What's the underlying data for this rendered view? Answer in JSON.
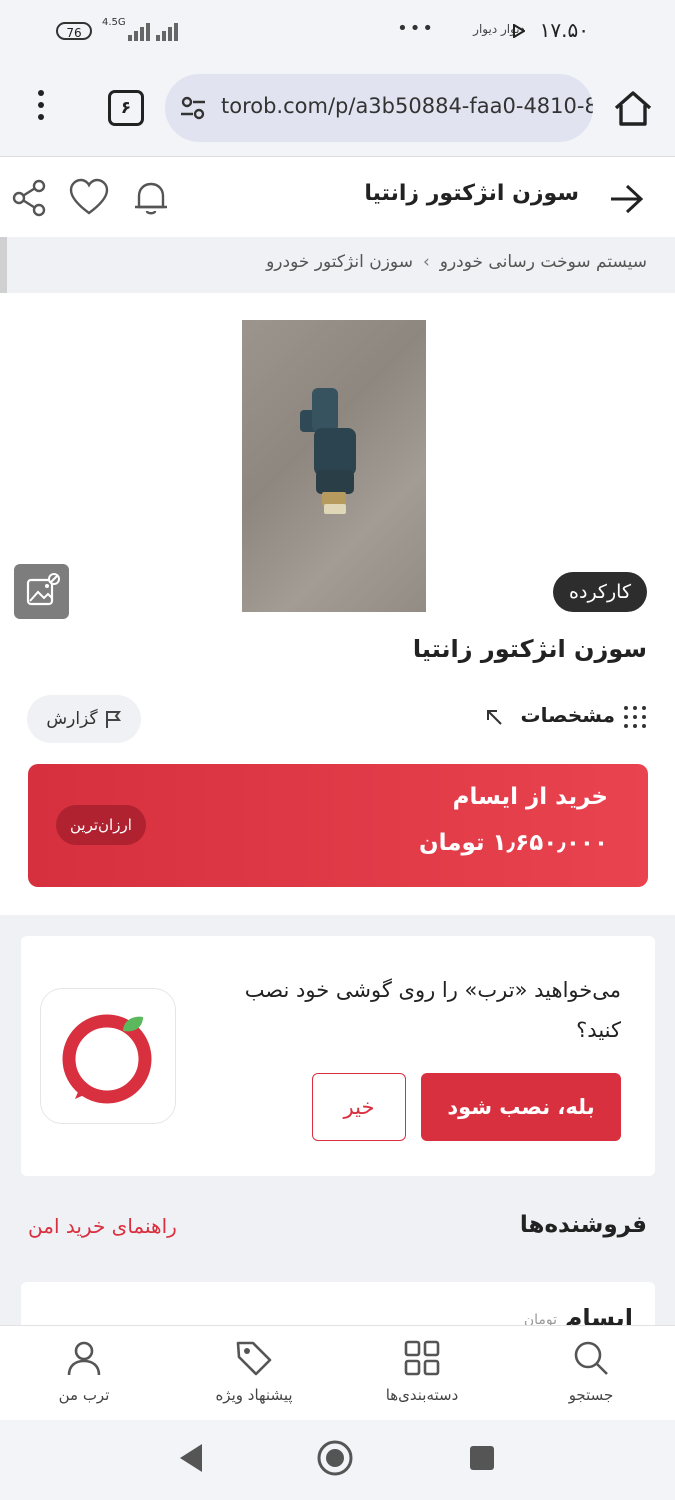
{
  "status_bar": {
    "time": "۱۷.۵۰",
    "apps": "دیوار  دیوار",
    "more": "•••",
    "battery": "76",
    "network": "4.5G"
  },
  "browser": {
    "url": "torob.com/p/a3b50884-faa0-4810-8",
    "tabs_count": "۶"
  },
  "header": {
    "title": "سوزن انژکتور زانتیا"
  },
  "breadcrumb": {
    "items": [
      "سیستم سوخت رسانی خودرو",
      "سوزن انژکتور خودرو"
    ],
    "separator": "›"
  },
  "product": {
    "condition_badge": "کارکرده",
    "title": "سوزن انژکتور زانتیا",
    "specs_label": "مشخصات",
    "report_label": "گزارش",
    "buy": {
      "seller_line": "خرید از ایسام",
      "price_line": "۱٫۶۵۰٫۰۰۰ تومان",
      "cheapest_badge": "ارزان‌ترین"
    }
  },
  "install_prompt": {
    "message": "می‌خواهید «ترب» را روی گوشی خود نصب کنید؟",
    "yes_label": "بله، نصب شود",
    "no_label": "خیر"
  },
  "sellers": {
    "title": "فروشنده‌ها",
    "safe_guide": "راهنمای خرید امن",
    "first_seller": "ایسام",
    "first_unit": "تومان"
  },
  "bottom_nav": {
    "search": "جستجو",
    "categories": "دسته‌بندی‌ها",
    "offers": "پیشنهاد ویژه",
    "profile": "ترب من"
  },
  "colors": {
    "brand_red": "#d9303f",
    "dark_badge": "#2d2d2d"
  }
}
